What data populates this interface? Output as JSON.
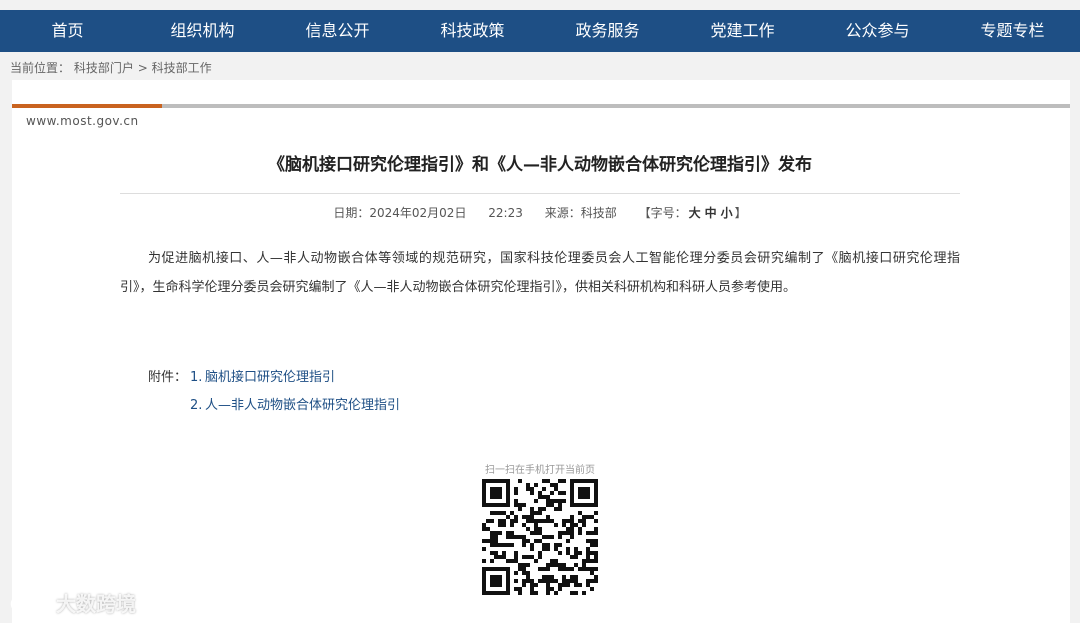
{
  "nav": {
    "items": [
      "首页",
      "组织机构",
      "信息公开",
      "科技政策",
      "政务服务",
      "党建工作",
      "公众参与",
      "专题专栏"
    ]
  },
  "breadcrumb": {
    "label": "当前位置：",
    "item1": "科技部门户",
    "separator": ">",
    "item2": "科技部工作"
  },
  "site": "www.most.gov.cn",
  "article": {
    "title": "《脑机接口研究伦理指引》和《人—非人动物嵌合体研究伦理指引》发布",
    "date_label": "日期：",
    "date": "2024年02月02日",
    "time": "22:23",
    "source_label": "来源：",
    "source": "科技部",
    "fontsize_open": "【字号：",
    "size_large": "大",
    "size_medium": "中",
    "size_small": "小",
    "fontsize_close": "】",
    "body": "为促进脑机接口、人—非人动物嵌合体等领域的规范研究，国家科技伦理委员会人工智能伦理分委员会研究编制了《脑机接口研究伦理指引》，生命科学伦理分委员会研究编制了《人—非人动物嵌合体研究伦理指引》，供相关科研机构和科研人员参考使用。"
  },
  "attachments": {
    "label": "附件：",
    "items": [
      {
        "num": "1.",
        "title": "脑机接口研究伦理指引"
      },
      {
        "num": "2.",
        "title": "人—非人动物嵌合体研究伦理指引"
      }
    ]
  },
  "qr": {
    "caption": "扫一扫在手机打开当前页"
  },
  "watermark": "大数跨境",
  "colors": {
    "nav_bg": "#1e4f85",
    "accent_bar": "#c9631f",
    "link": "#1e4f85"
  }
}
